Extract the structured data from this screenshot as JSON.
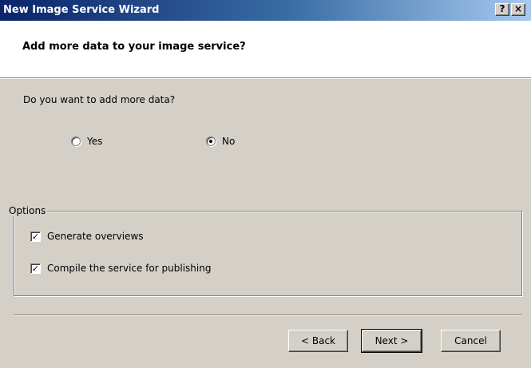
{
  "window": {
    "title": "New Image Service Wizard",
    "help_label": "?",
    "close_label": "×"
  },
  "header": {
    "title": "Add more data to your image service?"
  },
  "main": {
    "question": "Do you want to add more data?",
    "radio_options": [
      {
        "label": "Yes",
        "selected": false
      },
      {
        "label": "No",
        "selected": true
      }
    ]
  },
  "options": {
    "legend": "Options",
    "checkboxes": [
      {
        "label": "Generate overviews",
        "checked": true
      },
      {
        "label": "Compile the service for publishing",
        "checked": true
      }
    ]
  },
  "footer": {
    "back_label": "< Back",
    "next_label": "Next >",
    "cancel_label": "Cancel"
  }
}
